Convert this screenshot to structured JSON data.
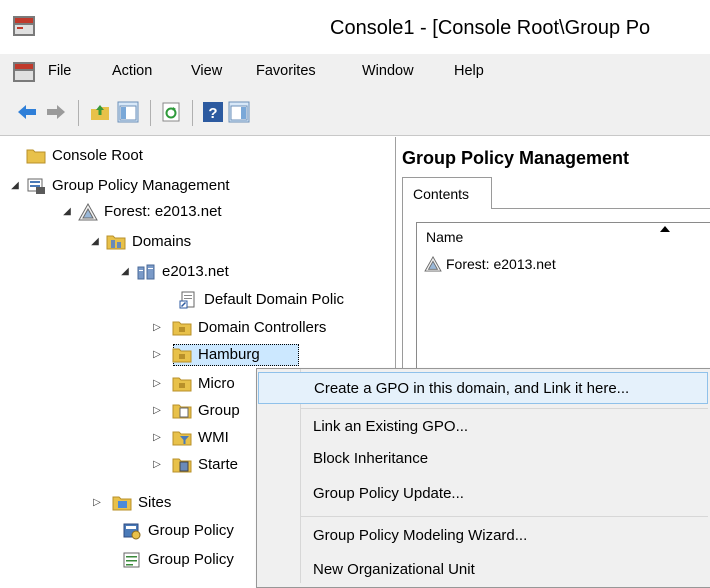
{
  "window": {
    "title": "Console1 - [Console Root\\Group Po"
  },
  "menu": [
    "File",
    "Action",
    "View",
    "Favorites",
    "Window",
    "Help"
  ],
  "toolbar": {
    "buttons": [
      "back-arrow-icon",
      "forward-arrow-icon",
      "up-folder-icon",
      "show-hide-tree-icon",
      "refresh-icon",
      "help-icon",
      "show-action-pane-icon"
    ]
  },
  "tree": {
    "console_root": "Console Root",
    "gpm": "Group Policy Management",
    "forest": "Forest: e2013.net",
    "domains": "Domains",
    "domain": "e2013.net",
    "default_policy": "Default Domain Polic",
    "domain_controllers": "Domain Controllers",
    "hamburg": "Hamburg",
    "micro": "Micro",
    "group": "Group",
    "wmi": "WMI",
    "starter": "Starte",
    "sites": "Sites",
    "gp_modeling": "Group Policy",
    "gp_results": "Group Policy"
  },
  "right_pane": {
    "title": "Group Policy Management",
    "tab": "Contents",
    "column_name": "Name",
    "rows": [
      "Forest: e2013.net"
    ]
  },
  "context_menu": {
    "items": [
      "Create a GPO in this domain, and Link it here...",
      "Link an Existing GPO...",
      "Block Inheritance",
      "Group Policy Update...",
      "Group Policy Modeling Wizard...",
      "New Organizational Unit"
    ],
    "highlighted_index": 0
  },
  "colors": {
    "menu_bg": "#f0f0f0",
    "highlight_bg": "#e5f1fb",
    "highlight_border": "#8fc1ea",
    "selection_bg": "#cce8ff",
    "folder_yellow": "#e8c14a"
  }
}
